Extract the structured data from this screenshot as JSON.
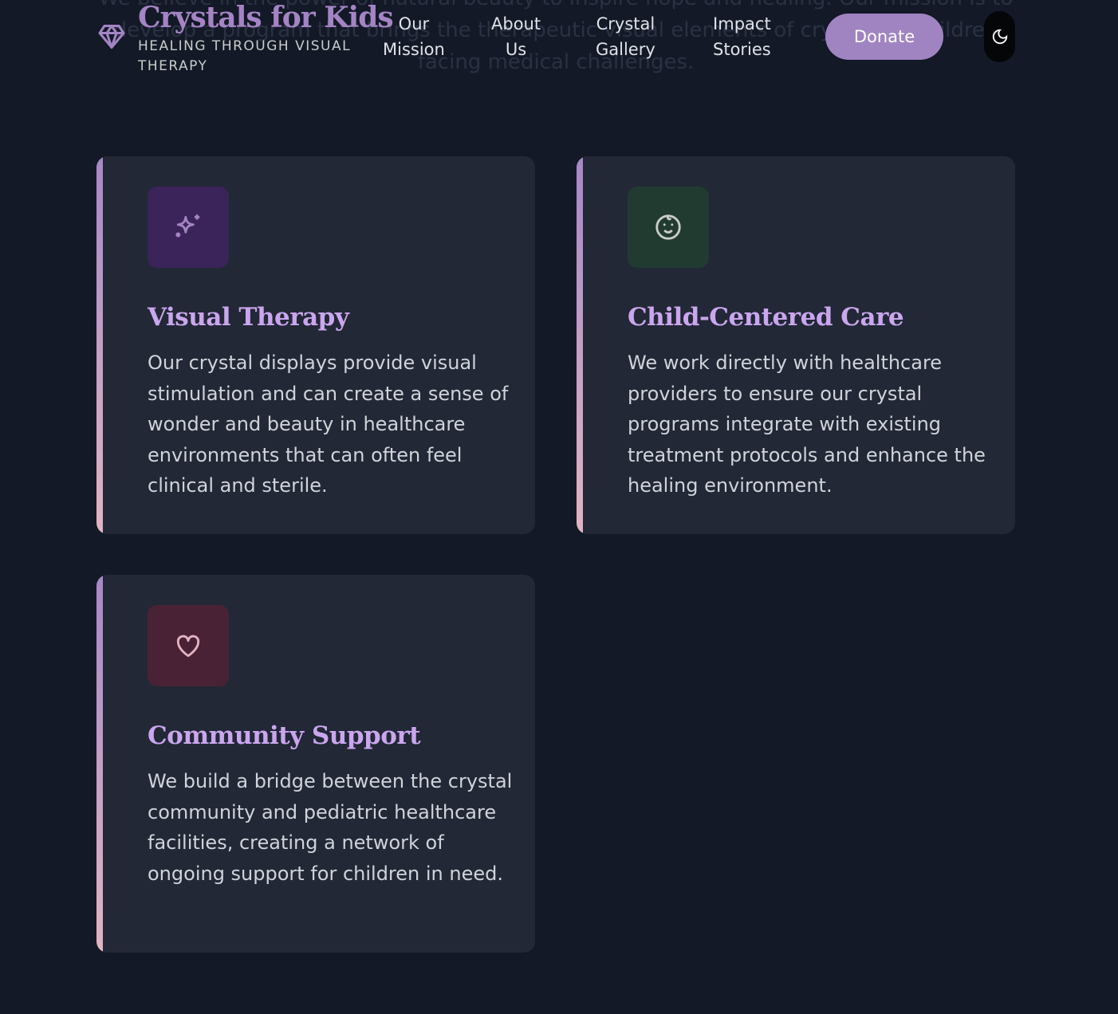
{
  "background_text": "We believe in the power of natural beauty to inspire hope and healing. Our mission is to develop a program that brings the therapeutic visual elements of crystals to children facing medical challenges.",
  "header": {
    "title": "Crystals for Kids",
    "subtitle": "HEALING THROUGH VISUAL THERAPY",
    "nav": [
      {
        "l1": "Our",
        "l2": "Mission"
      },
      {
        "l1": "About",
        "l2": "Us"
      },
      {
        "l1": "Crystal",
        "l2": "Gallery"
      },
      {
        "l1": "Impact",
        "l2": "Stories"
      }
    ],
    "donate": "Donate"
  },
  "cards": [
    {
      "title": "Visual Therapy",
      "text": "Our crystal displays provide visual stimulation and can create a sense of wonder and beauty in healthcare environments that can often feel clinical and sterile.",
      "icon": "sparkles-icon",
      "icon_bg": "#3b2459"
    },
    {
      "title": "Child-Centered Care",
      "text": "We work directly with healthcare providers to ensure our crystal programs integrate with existing treatment protocols and enhance the healing environment.",
      "icon": "baby-face-icon",
      "icon_bg": "#213b30"
    },
    {
      "title": "Community Support",
      "text": "We build a bridge between the crystal community and pediatric healthcare facilities, creating a network of ongoing support for children in need.",
      "icon": "heart-icon",
      "icon_bg": "#4a2236"
    }
  ]
}
